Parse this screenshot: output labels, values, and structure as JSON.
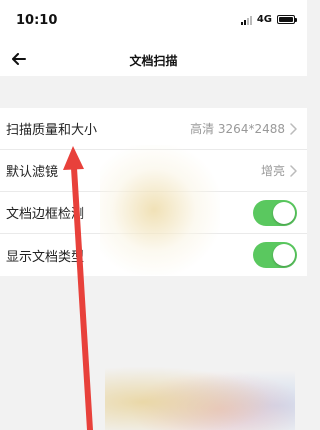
{
  "status_bar": {
    "time": "10:10",
    "network": "4G"
  },
  "nav": {
    "title": "文档扫描",
    "back_icon": "arrow-left-icon"
  },
  "settings": [
    {
      "label": "扫描质量和大小",
      "value": "高清 3264*2488",
      "control": "chevron"
    },
    {
      "label": "默认滤镜",
      "value": "增亮",
      "control": "chevron"
    },
    {
      "label": "文档边框检测",
      "control": "toggle",
      "on": true
    },
    {
      "label": "显示文档类型",
      "control": "toggle",
      "on": true
    }
  ],
  "colors": {
    "toggle_on": "#5ac85f",
    "annotation_arrow": "#e8413b"
  }
}
